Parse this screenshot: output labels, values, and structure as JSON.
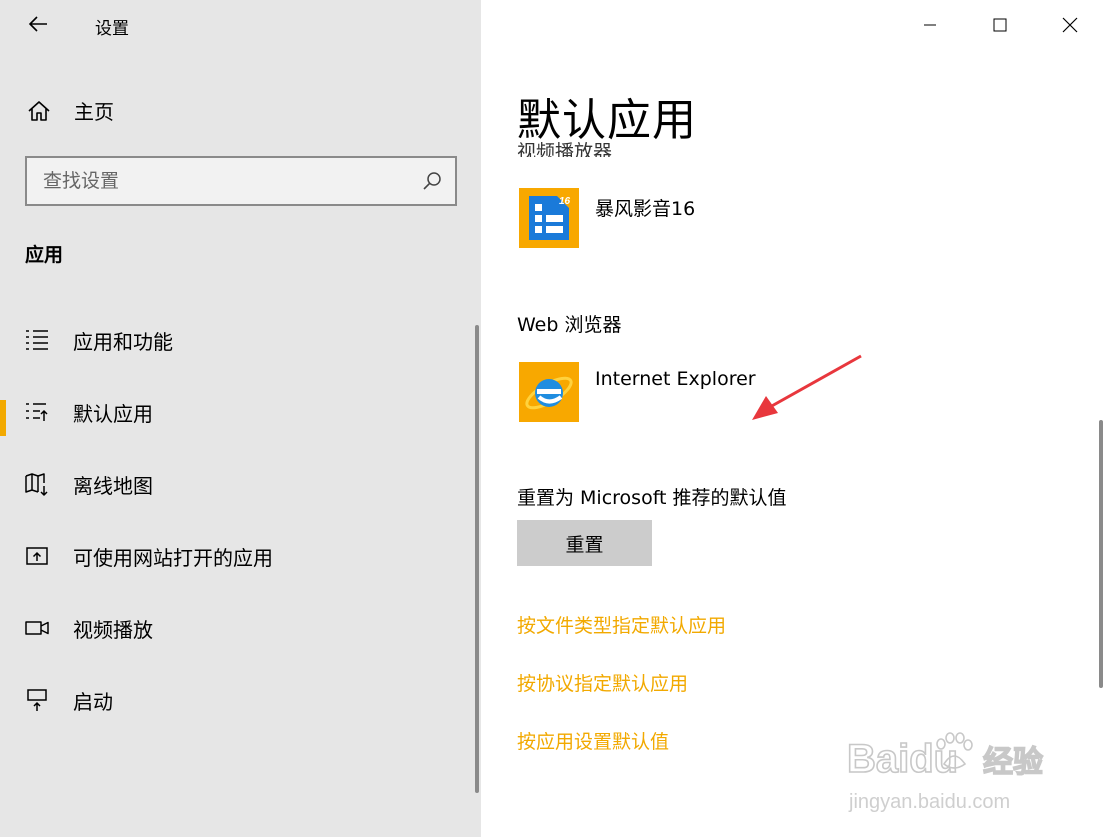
{
  "window": {
    "title": "设置"
  },
  "sidebar": {
    "home_label": "主页",
    "search_placeholder": "查找设置",
    "section_title": "应用",
    "items": [
      {
        "label": "应用和功能",
        "icon": "list-icon",
        "active": false
      },
      {
        "label": "默认应用",
        "icon": "default-list-icon",
        "active": true
      },
      {
        "label": "离线地图",
        "icon": "map-download-icon",
        "active": false
      },
      {
        "label": "可使用网站打开的应用",
        "icon": "open-external-icon",
        "active": false
      },
      {
        "label": "视频播放",
        "icon": "video-camera-icon",
        "active": false
      },
      {
        "label": "启动",
        "icon": "startup-icon",
        "active": false
      }
    ]
  },
  "main": {
    "title": "默认应用",
    "clipped_heading": "视频播放器",
    "video_player": {
      "app_name": "暴风影音16",
      "icon": "storm-player-icon",
      "badge": "16"
    },
    "web_browser": {
      "label": "Web 浏览器",
      "app_name": "Internet Explorer",
      "icon": "internet-explorer-icon"
    },
    "reset": {
      "label": "重置为 Microsoft 推荐的默认值",
      "button_label": "重置"
    },
    "links": [
      "按文件类型指定默认应用",
      "按协议指定默认应用",
      "按应用设置默认值"
    ]
  },
  "watermark": {
    "brand": "Baidu",
    "brand_suffix": "经验",
    "url": "jingyan.baidu.com"
  },
  "colors": {
    "accent": "#f2a900",
    "sidebar_bg": "#e6e6e6",
    "button_bg": "#cccccc",
    "annotation_arrow": "#e8373d"
  }
}
